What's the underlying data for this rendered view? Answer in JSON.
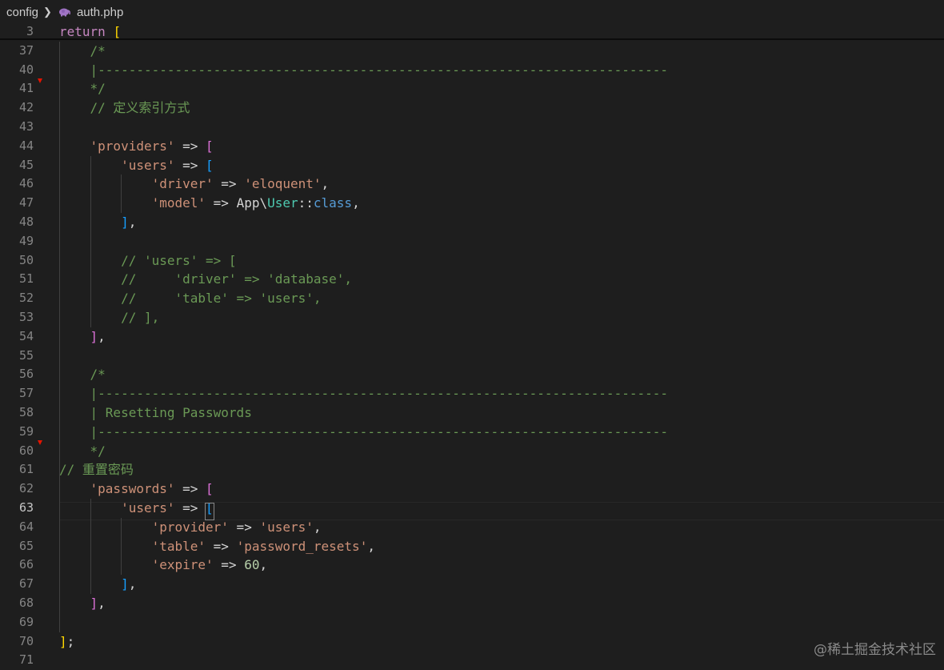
{
  "breadcrumb": {
    "folder": "config",
    "file": "auth.php"
  },
  "lines": [
    {
      "n": "3",
      "tokens": [
        [
          "kw",
          "return"
        ],
        [
          "t",
          " "
        ],
        [
          "b3",
          "["
        ]
      ]
    },
    {
      "n": "37",
      "tokens": [
        [
          "t",
          "    "
        ],
        [
          "cm",
          "/*"
        ]
      ]
    },
    {
      "n": "40",
      "tokens": [
        [
          "t",
          "    "
        ],
        [
          "cm",
          "|--------------------------------------------------------------------------"
        ]
      ]
    },
    {
      "n": "41",
      "tokens": [
        [
          "t",
          "    "
        ],
        [
          "cm",
          "*/"
        ]
      ]
    },
    {
      "n": "42",
      "tokens": [
        [
          "t",
          "    "
        ],
        [
          "cm",
          "// 定义索引方式"
        ]
      ]
    },
    {
      "n": "43",
      "tokens": []
    },
    {
      "n": "44",
      "tokens": [
        [
          "t",
          "    "
        ],
        [
          "str",
          "'providers'"
        ],
        [
          "t",
          " => "
        ],
        [
          "b1",
          "["
        ]
      ]
    },
    {
      "n": "45",
      "tokens": [
        [
          "t",
          "        "
        ],
        [
          "str",
          "'users'"
        ],
        [
          "t",
          " => "
        ],
        [
          "b2",
          "["
        ]
      ]
    },
    {
      "n": "46",
      "tokens": [
        [
          "t",
          "            "
        ],
        [
          "str",
          "'driver'"
        ],
        [
          "t",
          " => "
        ],
        [
          "str",
          "'eloquent'"
        ],
        [
          "t",
          ","
        ]
      ]
    },
    {
      "n": "47",
      "tokens": [
        [
          "t",
          "            "
        ],
        [
          "str",
          "'model'"
        ],
        [
          "t",
          " => App\\"
        ],
        [
          "cls",
          "User"
        ],
        [
          "t",
          "::"
        ],
        [
          "ck",
          "class"
        ],
        [
          "t",
          ","
        ]
      ]
    },
    {
      "n": "48",
      "tokens": [
        [
          "t",
          "        "
        ],
        [
          "b2",
          "]"
        ],
        [
          "t",
          ","
        ]
      ]
    },
    {
      "n": "49",
      "tokens": []
    },
    {
      "n": "50",
      "tokens": [
        [
          "t",
          "        "
        ],
        [
          "cm",
          "// 'users' => ["
        ]
      ]
    },
    {
      "n": "51",
      "tokens": [
        [
          "t",
          "        "
        ],
        [
          "cm",
          "//     'driver' => 'database',"
        ]
      ]
    },
    {
      "n": "52",
      "tokens": [
        [
          "t",
          "        "
        ],
        [
          "cm",
          "//     'table' => 'users',"
        ]
      ]
    },
    {
      "n": "53",
      "tokens": [
        [
          "t",
          "        "
        ],
        [
          "cm",
          "// ],"
        ]
      ]
    },
    {
      "n": "54",
      "tokens": [
        [
          "t",
          "    "
        ],
        [
          "b1",
          "]"
        ],
        [
          "t",
          ","
        ]
      ]
    },
    {
      "n": "55",
      "tokens": []
    },
    {
      "n": "56",
      "tokens": [
        [
          "t",
          "    "
        ],
        [
          "cm",
          "/*"
        ]
      ]
    },
    {
      "n": "57",
      "tokens": [
        [
          "t",
          "    "
        ],
        [
          "cm",
          "|--------------------------------------------------------------------------"
        ]
      ]
    },
    {
      "n": "58",
      "tokens": [
        [
          "t",
          "    "
        ],
        [
          "cm",
          "| Resetting Passwords"
        ]
      ]
    },
    {
      "n": "59",
      "tokens": [
        [
          "t",
          "    "
        ],
        [
          "cm",
          "|--------------------------------------------------------------------------"
        ]
      ]
    },
    {
      "n": "60",
      "tokens": [
        [
          "t",
          "    "
        ],
        [
          "cm",
          "*/"
        ]
      ]
    },
    {
      "n": "61",
      "tokens": [
        [
          "cm",
          "// 重置密码"
        ]
      ]
    },
    {
      "n": "62",
      "tokens": [
        [
          "t",
          "    "
        ],
        [
          "str",
          "'passwords'"
        ],
        [
          "t",
          " => "
        ],
        [
          "b1",
          "["
        ]
      ]
    },
    {
      "n": "63",
      "tokens": [
        [
          "t",
          "        "
        ],
        [
          "str",
          "'users'"
        ],
        [
          "t",
          " => "
        ],
        [
          "b2",
          "["
        ]
      ]
    },
    {
      "n": "64",
      "tokens": [
        [
          "t",
          "            "
        ],
        [
          "str",
          "'provider'"
        ],
        [
          "t",
          " => "
        ],
        [
          "str",
          "'users'"
        ],
        [
          "t",
          ","
        ]
      ]
    },
    {
      "n": "65",
      "tokens": [
        [
          "t",
          "            "
        ],
        [
          "str",
          "'table'"
        ],
        [
          "t",
          " => "
        ],
        [
          "str",
          "'password_resets'"
        ],
        [
          "t",
          ","
        ]
      ]
    },
    {
      "n": "66",
      "tokens": [
        [
          "t",
          "            "
        ],
        [
          "str",
          "'expire'"
        ],
        [
          "t",
          " => "
        ],
        [
          "num",
          "60"
        ],
        [
          "t",
          ","
        ]
      ]
    },
    {
      "n": "67",
      "tokens": [
        [
          "t",
          "        "
        ],
        [
          "b2",
          "]"
        ],
        [
          "t",
          ","
        ]
      ]
    },
    {
      "n": "68",
      "tokens": [
        [
          "t",
          "    "
        ],
        [
          "b1",
          "]"
        ],
        [
          "t",
          ","
        ]
      ]
    },
    {
      "n": "69",
      "tokens": []
    },
    {
      "n": "70",
      "tokens": [
        [
          "b3",
          "]"
        ],
        [
          "t",
          ";"
        ]
      ]
    },
    {
      "n": "71",
      "tokens": []
    }
  ],
  "active_line": "63",
  "watermark": "@稀土掘金技术社区",
  "colors": {
    "background": "#1e1e1e",
    "comment": "#6a9955",
    "string": "#ce9178",
    "keyword": "#c586c0",
    "class": "#4ec9b0",
    "number": "#b5cea8"
  }
}
